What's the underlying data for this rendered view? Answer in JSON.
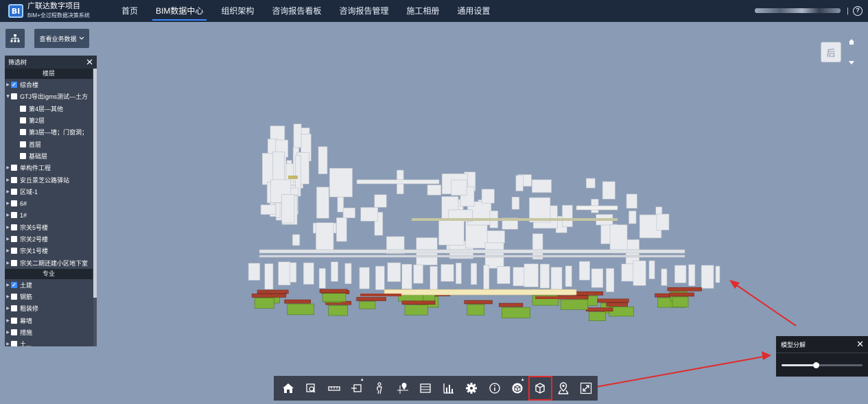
{
  "header": {
    "logo_text": "BI",
    "project_name": "广联达数字项目",
    "system_name": "BIM+全过程数据决策系统",
    "nav": [
      {
        "label": "首页",
        "active": false
      },
      {
        "label": "BIM数据中心",
        "active": true
      },
      {
        "label": "组织架构",
        "active": false
      },
      {
        "label": "咨询报告看板",
        "active": false
      },
      {
        "label": "咨询报告管理",
        "active": false
      },
      {
        "label": "施工相册",
        "active": false
      },
      {
        "label": "通用设置",
        "active": false
      }
    ],
    "separator": "|",
    "help_icon": "?"
  },
  "left_toolbar": {
    "tree_icon": "org-tree-icon",
    "business_data_label": "查看业务数据",
    "dropdown_icon": "chevron-down-icon"
  },
  "filter_panel": {
    "title": "筛选树",
    "close": "✕",
    "floor_section": "楼层",
    "discipline_section": "专业",
    "floor_items": [
      {
        "label": "综合楼",
        "checked": true,
        "arrow": "right",
        "level": 0
      },
      {
        "label": "GTJ导出igms测试—土方",
        "checked": false,
        "arrow": "down",
        "level": 0
      },
      {
        "label": "第4层—其他",
        "checked": false,
        "arrow": "none",
        "level": 1
      },
      {
        "label": "第2层",
        "checked": false,
        "arrow": "none",
        "level": 1
      },
      {
        "label": "第3层—墙；门窗洞；",
        "checked": false,
        "arrow": "none",
        "level": 1
      },
      {
        "label": "首层",
        "checked": false,
        "arrow": "none",
        "level": 1
      },
      {
        "label": "基础层",
        "checked": false,
        "arrow": "none",
        "level": 1
      },
      {
        "label": "单构件工程",
        "checked": false,
        "arrow": "right",
        "level": 0
      },
      {
        "label": "安丘景芝公路驿站",
        "checked": false,
        "arrow": "right",
        "level": 0
      },
      {
        "label": "区域-1",
        "checked": false,
        "arrow": "right",
        "level": 0
      },
      {
        "label": "6#",
        "checked": false,
        "arrow": "right",
        "level": 0
      },
      {
        "label": "1#",
        "checked": false,
        "arrow": "right",
        "level": 0
      },
      {
        "label": "宗关5号楼",
        "checked": false,
        "arrow": "right",
        "level": 0
      },
      {
        "label": "宗关2号楼",
        "checked": false,
        "arrow": "right",
        "level": 0
      },
      {
        "label": "宗关1号楼",
        "checked": false,
        "arrow": "right",
        "level": 0
      },
      {
        "label": "宗关二期还建小区地下室",
        "checked": false,
        "arrow": "right",
        "level": 0
      }
    ],
    "discipline_items": [
      {
        "label": "土建",
        "checked": true,
        "arrow": "right"
      },
      {
        "label": "钢筋",
        "checked": false,
        "arrow": "right"
      },
      {
        "label": "粗装修",
        "checked": false,
        "arrow": "right"
      },
      {
        "label": "幕墙",
        "checked": false,
        "arrow": "right"
      },
      {
        "label": "措施",
        "checked": false,
        "arrow": "right"
      },
      {
        "label": "土...",
        "checked": false,
        "arrow": "right"
      }
    ]
  },
  "view_cube": {
    "label": "后"
  },
  "bottom_toolbar": {
    "tools": [
      {
        "icon": "home-icon",
        "caret": false,
        "highlight": false
      },
      {
        "icon": "zoom-box-icon",
        "caret": false,
        "highlight": false
      },
      {
        "icon": "measure-icon",
        "caret": false,
        "highlight": false
      },
      {
        "icon": "section-icon",
        "caret": true,
        "highlight": false
      },
      {
        "icon": "person-walk-icon",
        "caret": false,
        "highlight": false
      },
      {
        "icon": "locate-pin-icon",
        "caret": false,
        "highlight": false
      },
      {
        "icon": "list-icon",
        "caret": false,
        "highlight": false
      },
      {
        "icon": "bar-chart-icon",
        "caret": false,
        "highlight": false
      },
      {
        "icon": "gear-icon",
        "caret": false,
        "highlight": false
      },
      {
        "icon": "info-icon",
        "caret": false,
        "highlight": false
      },
      {
        "icon": "model-sphere-icon",
        "caret": true,
        "highlight": false
      },
      {
        "icon": "explode-box-icon",
        "caret": false,
        "highlight": true
      },
      {
        "icon": "map-pin-icon",
        "caret": false,
        "highlight": false
      },
      {
        "icon": "fullscreen-icon",
        "caret": false,
        "highlight": false
      }
    ]
  },
  "explode_popup": {
    "title": "模型分解",
    "close": "✕",
    "slider_value": 0.42
  },
  "colors": {
    "viewport_bg": "#8a9bb5",
    "topbar_bg": "#1d2a3e",
    "accent": "#3d8bff",
    "annotation": "#e02b2b"
  }
}
